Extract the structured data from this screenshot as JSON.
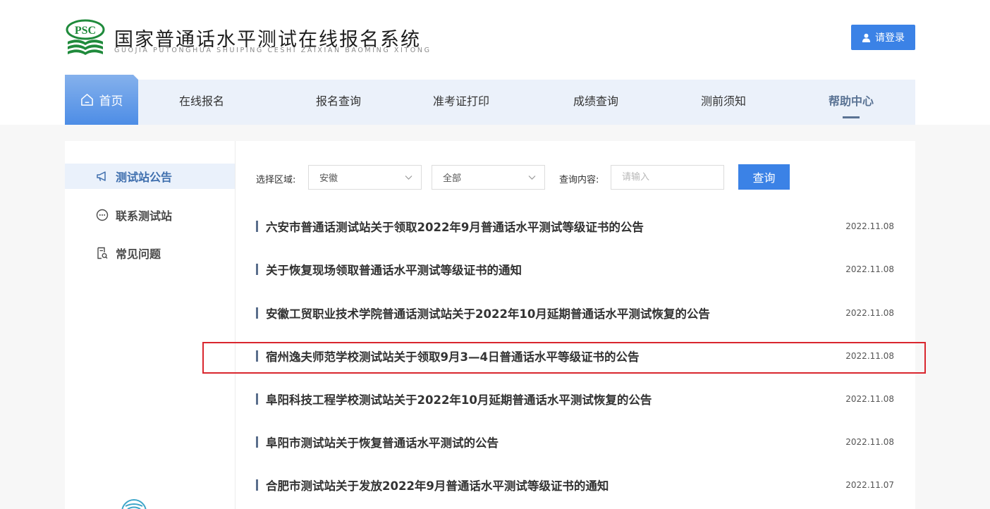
{
  "header": {
    "logo_text": "PSC",
    "title": "国家普通话水平测试在线报名系统",
    "subtitle": "GUOJIA PUTONGHUA SHUIPING CESHI ZAIXIAN BAOMING XITONG",
    "login_label": "请登录"
  },
  "nav": {
    "home": "首页",
    "items": [
      "在线报名",
      "报名查询",
      "准考证打印",
      "成绩查询",
      "测前须知",
      "帮助中心"
    ],
    "active": "帮助中心"
  },
  "sidebar": {
    "items": [
      {
        "label": "测试站公告",
        "icon": "megaphone-icon",
        "active": true
      },
      {
        "label": "联系测试站",
        "icon": "chat-bubble-icon",
        "active": false
      },
      {
        "label": "常见问题",
        "icon": "document-search-icon",
        "active": false
      }
    ]
  },
  "filters": {
    "region_label": "选择区域:",
    "region_value": "安徽",
    "scope_value": "全部",
    "query_label": "查询内容:",
    "query_placeholder": "请输入",
    "search_button": "查询"
  },
  "notices": [
    {
      "title": "六安市普通话测试站关于领取2022年9月普通话水平测试等级证书的公告",
      "date": "2022.11.08"
    },
    {
      "title": "关于恢复现场领取普通话水平测试等级证书的通知",
      "date": "2022.11.08"
    },
    {
      "title": "安徽工贸职业技术学院普通话测试站关于2022年10月延期普通话水平测试恢复的公告",
      "date": "2022.11.08"
    },
    {
      "title": "宿州逸夫师范学校测试站关于领取9月3—4日普通话水平等级证书的公告",
      "date": "2022.11.08"
    },
    {
      "title": "阜阳科技工程学校测试站关于2022年10月延期普通话水平测试恢复的公告",
      "date": "2022.11.08"
    },
    {
      "title": "阜阳市测试站关于恢复普通话水平测试的公告",
      "date": "2022.11.08"
    },
    {
      "title": "合肥市测试站关于发放2022年9月普通话水平测试等级证书的通知",
      "date": "2022.11.07"
    }
  ],
  "colors": {
    "accent": "#3b82e6",
    "nav_bg": "#ebf1fa",
    "active_text": "#3f6fae",
    "highlight": "#d9262e",
    "logo_green": "#1f8a3b"
  }
}
